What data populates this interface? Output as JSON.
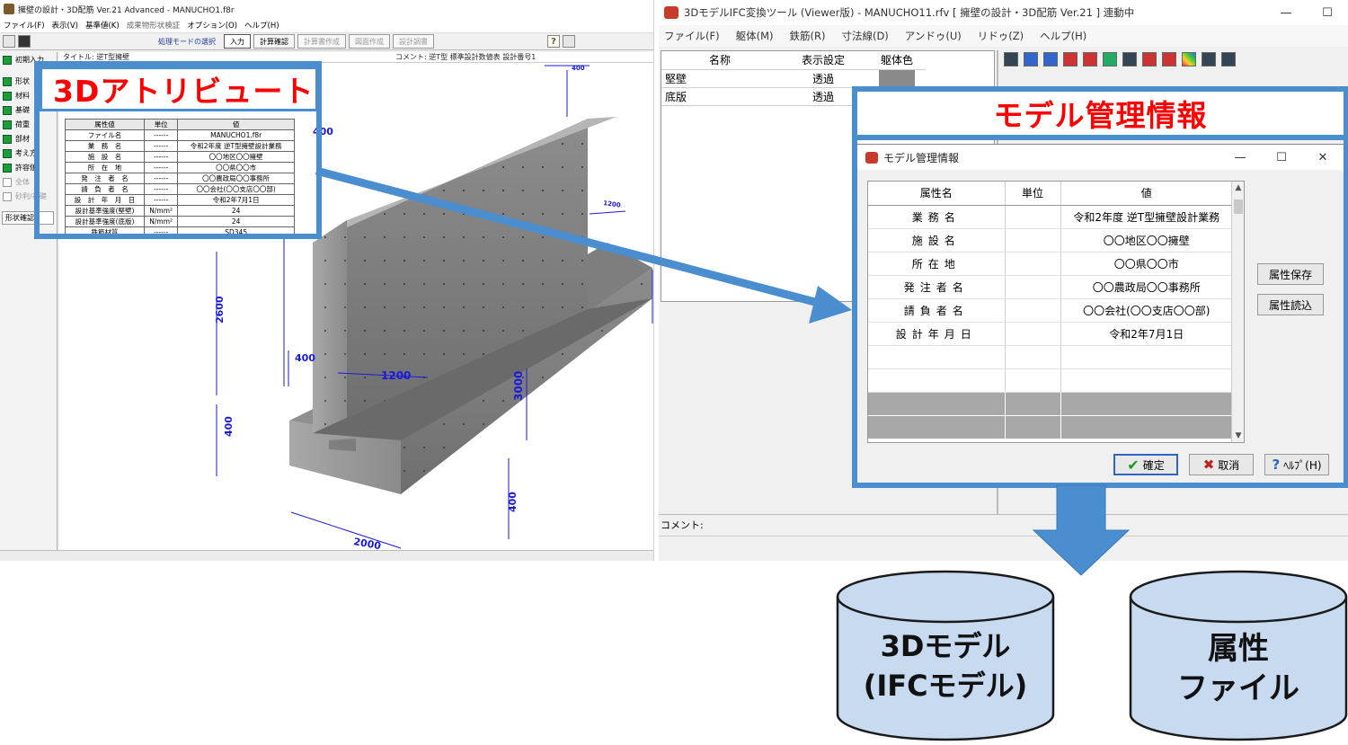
{
  "left_app": {
    "title": "擁壁の設計・3D配筋 Ver.21 Advanced - MANUCHO1.f8r",
    "menu": [
      "ファイル(F)",
      "表示(V)",
      "基準値(K)",
      "成果物形状検証",
      "オプション(O)",
      "ヘルプ(H)"
    ],
    "toolbar": {
      "mode_label": "処理モードの選択",
      "buttons": [
        "入力",
        "計算確認",
        "計算書作成",
        "図面作成",
        "設計調書"
      ]
    },
    "sidebar": {
      "items": [
        {
          "label": "初期入力",
          "checked": true
        },
        {
          "label": "形状",
          "checked": true
        },
        {
          "label": "材料",
          "checked": true
        },
        {
          "label": "基礎",
          "checked": true
        },
        {
          "label": "荷重",
          "checked": true
        },
        {
          "label": "部材",
          "checked": true
        },
        {
          "label": "考え方",
          "checked": true
        },
        {
          "label": "許容値",
          "checked": true
        },
        {
          "label": "全体",
          "checked": false
        },
        {
          "label": "砂利/基礎",
          "checked": false
        }
      ],
      "shape_tab": "形状確認"
    },
    "content_header": {
      "title": "タイトル: 逆T型擁壁",
      "comment": "コメント: 逆T型 標準設計数値表 設計番号1"
    },
    "attr_table": {
      "headers": [
        "属性値",
        "単位",
        "値"
      ],
      "rows": [
        [
          "ファイル名",
          "------",
          "MANUCHO1.f8r"
        ],
        [
          "業　務　名",
          "------",
          "令和2年度 逆T型擁壁設計業務"
        ],
        [
          "施　設　名",
          "------",
          "〇〇地区〇〇擁壁"
        ],
        [
          "所　在　地",
          "------",
          "〇〇県〇〇市"
        ],
        [
          "発　注　者　名",
          "------",
          "〇〇農政局〇〇事務所"
        ],
        [
          "請　負　者　名",
          "------",
          "〇〇会社(〇〇支店〇〇部)"
        ],
        [
          "設　計　年　月　日",
          "------",
          "令和2年7月1日"
        ],
        [
          "設計基準強度(堅壁)",
          "N/mm²",
          "24"
        ],
        [
          "設計基準強度(底版)",
          "N/mm²",
          "24"
        ],
        [
          "鉄筋材質",
          "------",
          "SD345"
        ]
      ]
    },
    "dimensions": {
      "top_400": "400",
      "d_400_left": "400",
      "d_1200_top": "1200",
      "d_2600": "2600",
      "d_400_mid": "400",
      "d_1200": "1200",
      "d_3000": "3000",
      "d_400_bottom": "400",
      "d_400_right": "400",
      "d_2000": "2000"
    },
    "callout_label": "3Dアトリビュート"
  },
  "right_app": {
    "title": "3DモデルIFC変換ツール (Viewer版) - MANUCHO11.rfv [ 擁壁の設計・3D配筋 Ver.21 ] 連動中",
    "window_controls": [
      "—",
      "☐"
    ],
    "menu": [
      "ファイル(F)",
      "躯体(M)",
      "鉄筋(R)",
      "寸法線(D)",
      "アンドゥ(U)",
      "リドゥ(Z)",
      "ヘルプ(H)"
    ],
    "grid": {
      "headers": [
        "名称",
        "表示設定",
        "躯体色"
      ],
      "rows": [
        {
          "name": "堅壁",
          "display": "透過"
        },
        {
          "name": "底版",
          "display": "透過"
        }
      ]
    },
    "comment_label": "コメント:",
    "callout_label": "モデル管理情報"
  },
  "dialog": {
    "title": "モデル管理情報",
    "window_controls": [
      "—",
      "☐",
      "✕"
    ],
    "headers": [
      "属性名",
      "単位",
      "値"
    ],
    "rows": [
      [
        "業務名",
        "",
        "令和2年度 逆T型擁壁設計業務"
      ],
      [
        "施設名",
        "",
        "〇〇地区〇〇擁壁"
      ],
      [
        "所在地",
        "",
        "〇〇県〇〇市"
      ],
      [
        "発注者名",
        "",
        "〇〇農政局〇〇事務所"
      ],
      [
        "請負者名",
        "",
        "〇〇会社(〇〇支店〇〇部)"
      ],
      [
        "設計年月日",
        "",
        "令和2年7月1日"
      ]
    ],
    "side_buttons": [
      "属性保存",
      "属性読込"
    ],
    "ok_label": "確定",
    "cancel_label": "取消",
    "help_label": "ﾍﾙﾌﾟ(H)"
  },
  "outputs": {
    "cylinder1_line1": "3Dモデル",
    "cylinder1_line2": "(IFCモデル)",
    "cylinder2_line1": "属性",
    "cylinder2_line2": "ファイル"
  },
  "colors": {
    "callout_border": "#4a8ed0",
    "callout_text": "#ff0000",
    "arrow": "#4a8ed0",
    "cylinder_fill": "#c7daf0",
    "dimension_line": "#1a1adc"
  }
}
